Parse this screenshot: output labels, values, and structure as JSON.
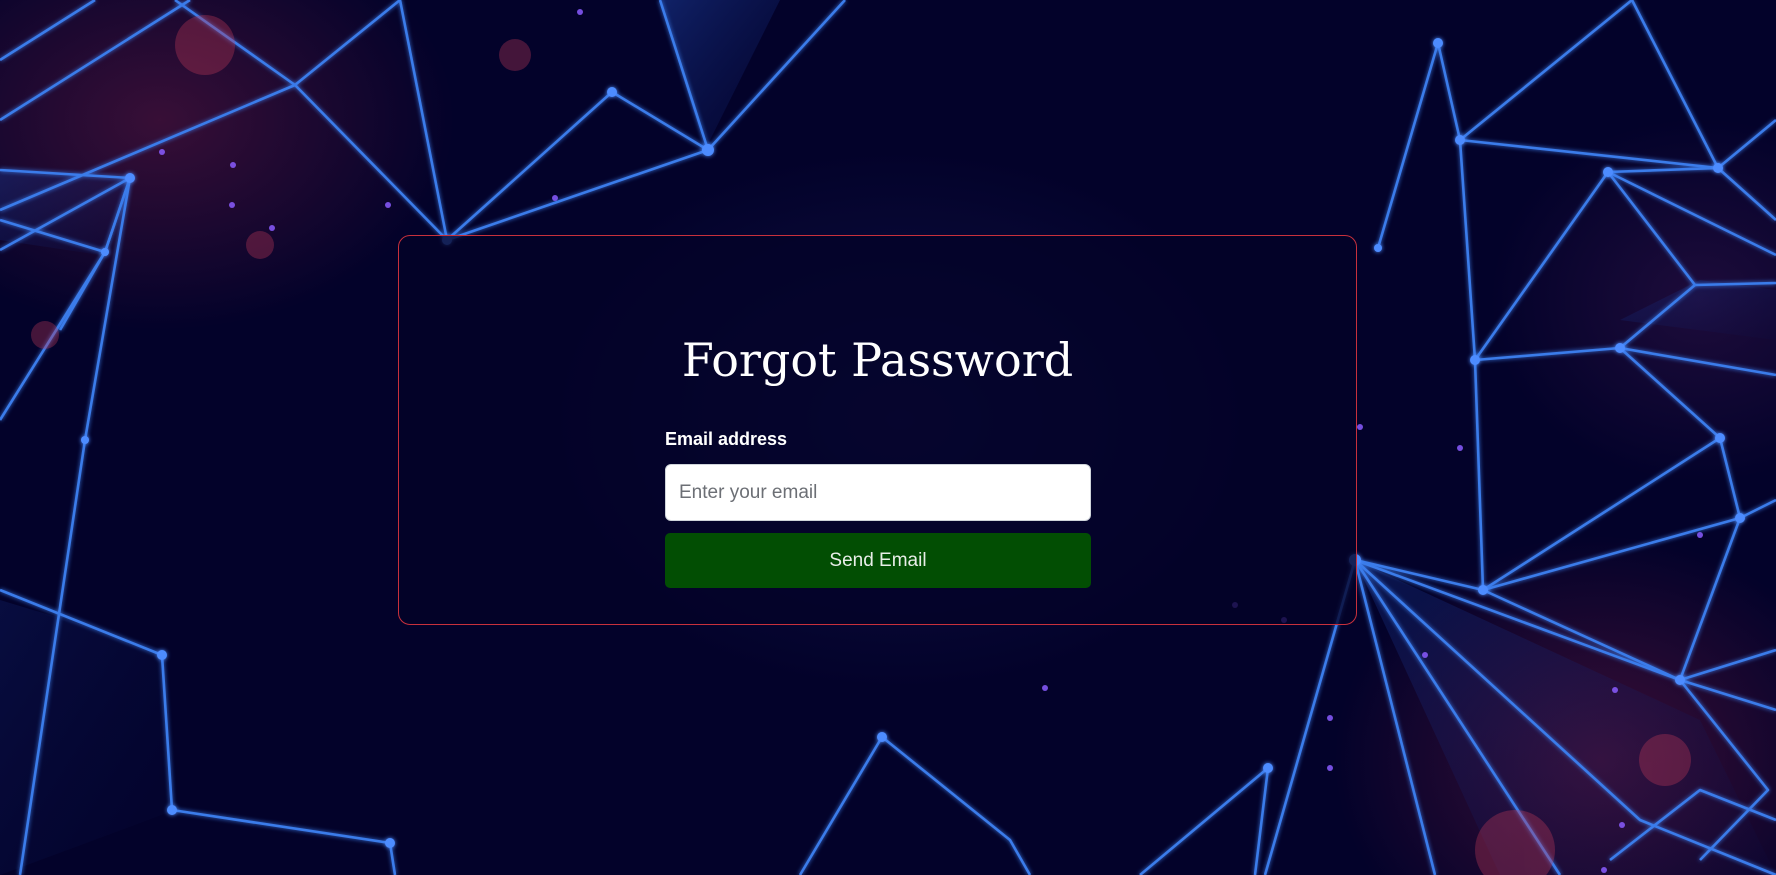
{
  "page": {
    "title": "Forgot Password"
  },
  "form": {
    "email_label": "Email address",
    "email_placeholder": "Enter your email",
    "email_value": "",
    "submit_label": "Send Email"
  },
  "colors": {
    "background": "#03022a",
    "card_border": "#c8303c",
    "button": "#024e03",
    "network_lines": "#3a7bea"
  },
  "decor": {
    "background_image": "blue-polygon-network-illustration"
  }
}
